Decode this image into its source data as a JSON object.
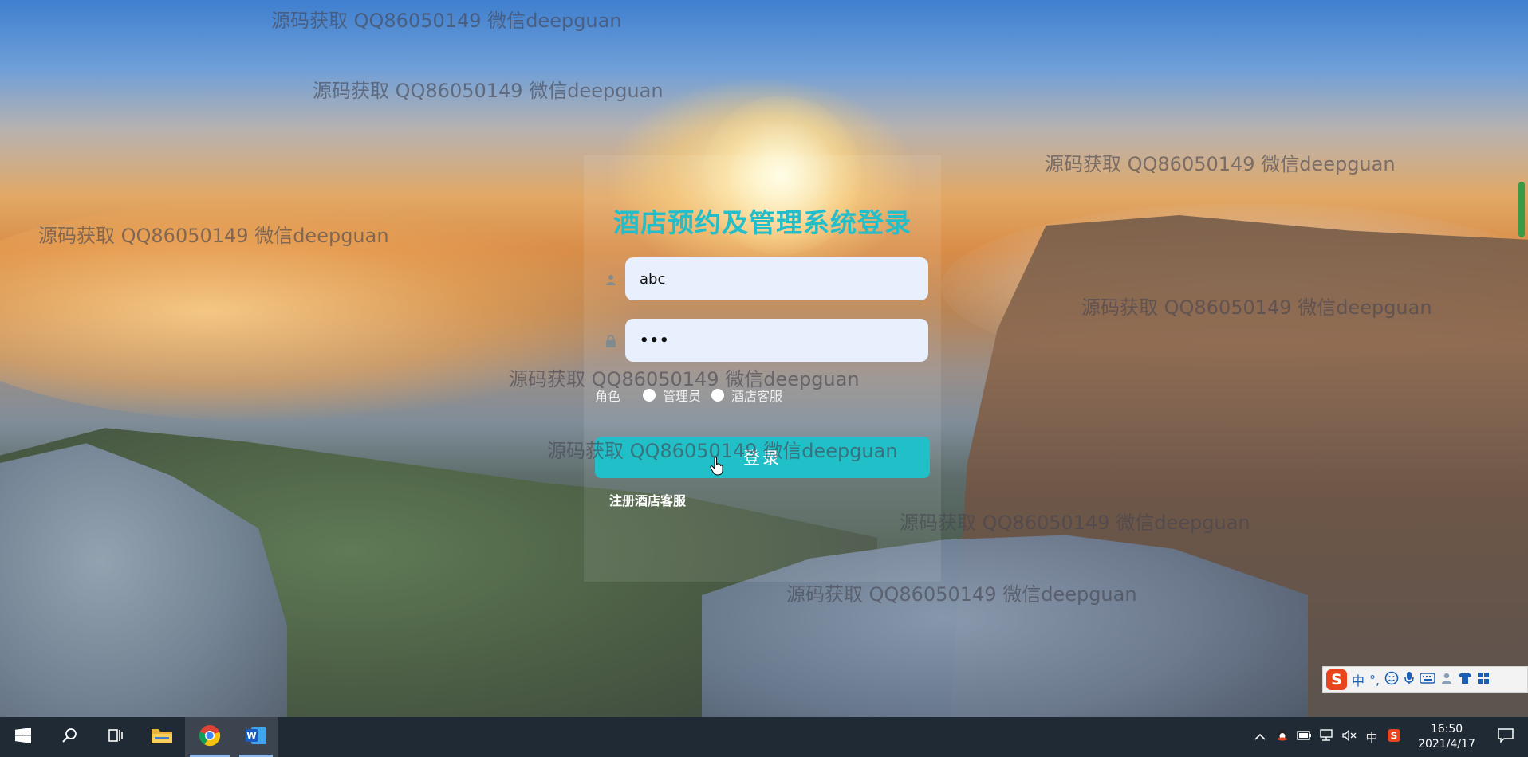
{
  "watermark_text": "源码获取 QQ86050149 微信deepguan",
  "login": {
    "title": "酒店预约及管理系统登录",
    "username_value": "abc",
    "password_value": "•••",
    "role_label": "角色",
    "role_options": [
      "管理员",
      "酒店客服"
    ],
    "login_button": "登录",
    "register_link": "注册酒店客服",
    "accent_color": "#23bec9"
  },
  "ime": {
    "logo": "S",
    "mode": "中",
    "punct": "°,",
    "icons": [
      "emoji-icon",
      "mic-icon",
      "keyboard-icon",
      "user-icon",
      "shirt-icon",
      "grid-icon"
    ]
  },
  "taskbar": {
    "apps": [
      "windows-start-icon",
      "search-icon",
      "task-view-icon",
      "file-explorer-icon",
      "chrome-icon",
      "word-icon"
    ],
    "tray": {
      "ime_mode": "中",
      "time": "16:50",
      "date": "2021/4/17"
    }
  }
}
